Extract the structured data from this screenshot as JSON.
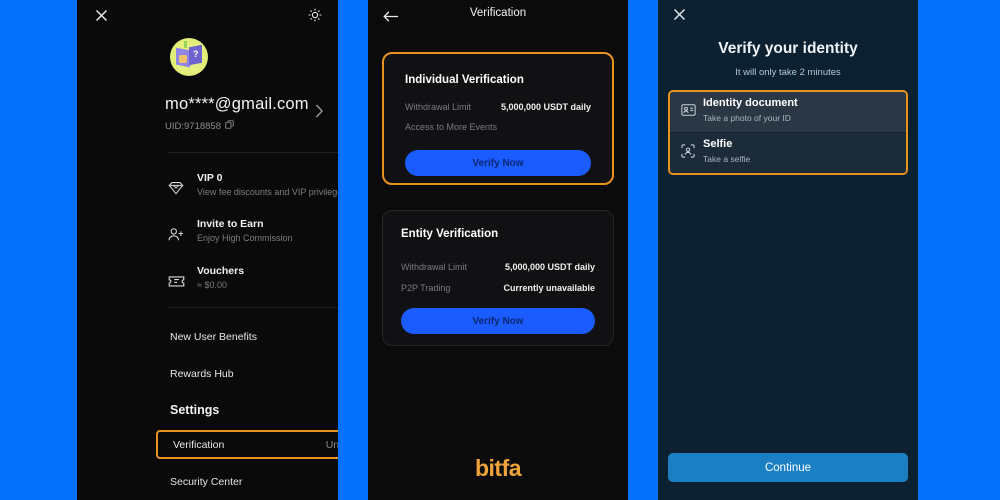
{
  "colors": {
    "page_background": "#0671fa",
    "panel_dark": "#0a0a0a",
    "panel_navy": "#0b2031",
    "highlight_orange": "#e8921f",
    "accent_blue": "#1a5cff",
    "continue_blue": "#1b7fc4",
    "brand_orange": "#f0a33a"
  },
  "account_panel": {
    "close_icon": "close-icon",
    "brightness_icon": "sun-icon",
    "avatar": "user-avatar",
    "email": "mo****@gmail.com",
    "uid_label": "UID:9718858",
    "copy_icon": "copy-icon",
    "chevron_icon": "chevron-right-icon",
    "features": [
      {
        "icon": "vip-diamond-icon",
        "title": "VIP 0",
        "subtitle": "View fee discounts and VIP privileges"
      },
      {
        "icon": "invite-user-icon",
        "title": "Invite to Earn",
        "subtitle": "Enjoy High Commission"
      },
      {
        "icon": "voucher-ticket-icon",
        "title": "Vouchers",
        "subtitle": "≈ $0.00"
      }
    ],
    "nav_items": [
      {
        "label": "New User Benefits",
        "value": ""
      },
      {
        "label": "Rewards Hub",
        "value": ""
      }
    ],
    "settings_heading": "Settings",
    "settings_items": [
      {
        "label": "Verification",
        "value": "Unverified",
        "highlighted": true
      },
      {
        "label": "Security Center",
        "value": "",
        "highlighted": false
      }
    ]
  },
  "verification_panel": {
    "back_icon": "arrow-left-icon",
    "title": "Verification",
    "cards": [
      {
        "title": "Individual Verification",
        "highlighted": true,
        "rows": [
          {
            "key": "Withdrawal Limit",
            "value": "5,000,000 USDT daily"
          },
          {
            "key": "Access to More Events",
            "value": ""
          }
        ],
        "button_label": "Verify Now"
      },
      {
        "title": "Entity Verification",
        "highlighted": false,
        "rows": [
          {
            "key": "Withdrawal Limit",
            "value": "5,000,000 USDT daily"
          },
          {
            "key": "P2P Trading",
            "value": "Currently unavailable"
          }
        ],
        "button_label": "Verify Now"
      }
    ],
    "brand_logo": "bitfa"
  },
  "identity_panel": {
    "close_icon": "close-icon",
    "title": "Verify your identity",
    "subtitle": "It will only take 2 minutes",
    "options": [
      {
        "icon": "id-card-icon",
        "title": "Identity document",
        "subtitle": "Take a photo of your ID"
      },
      {
        "icon": "face-scan-icon",
        "title": "Selfie",
        "subtitle": "Take a selfie"
      }
    ],
    "continue_label": "Continue"
  }
}
